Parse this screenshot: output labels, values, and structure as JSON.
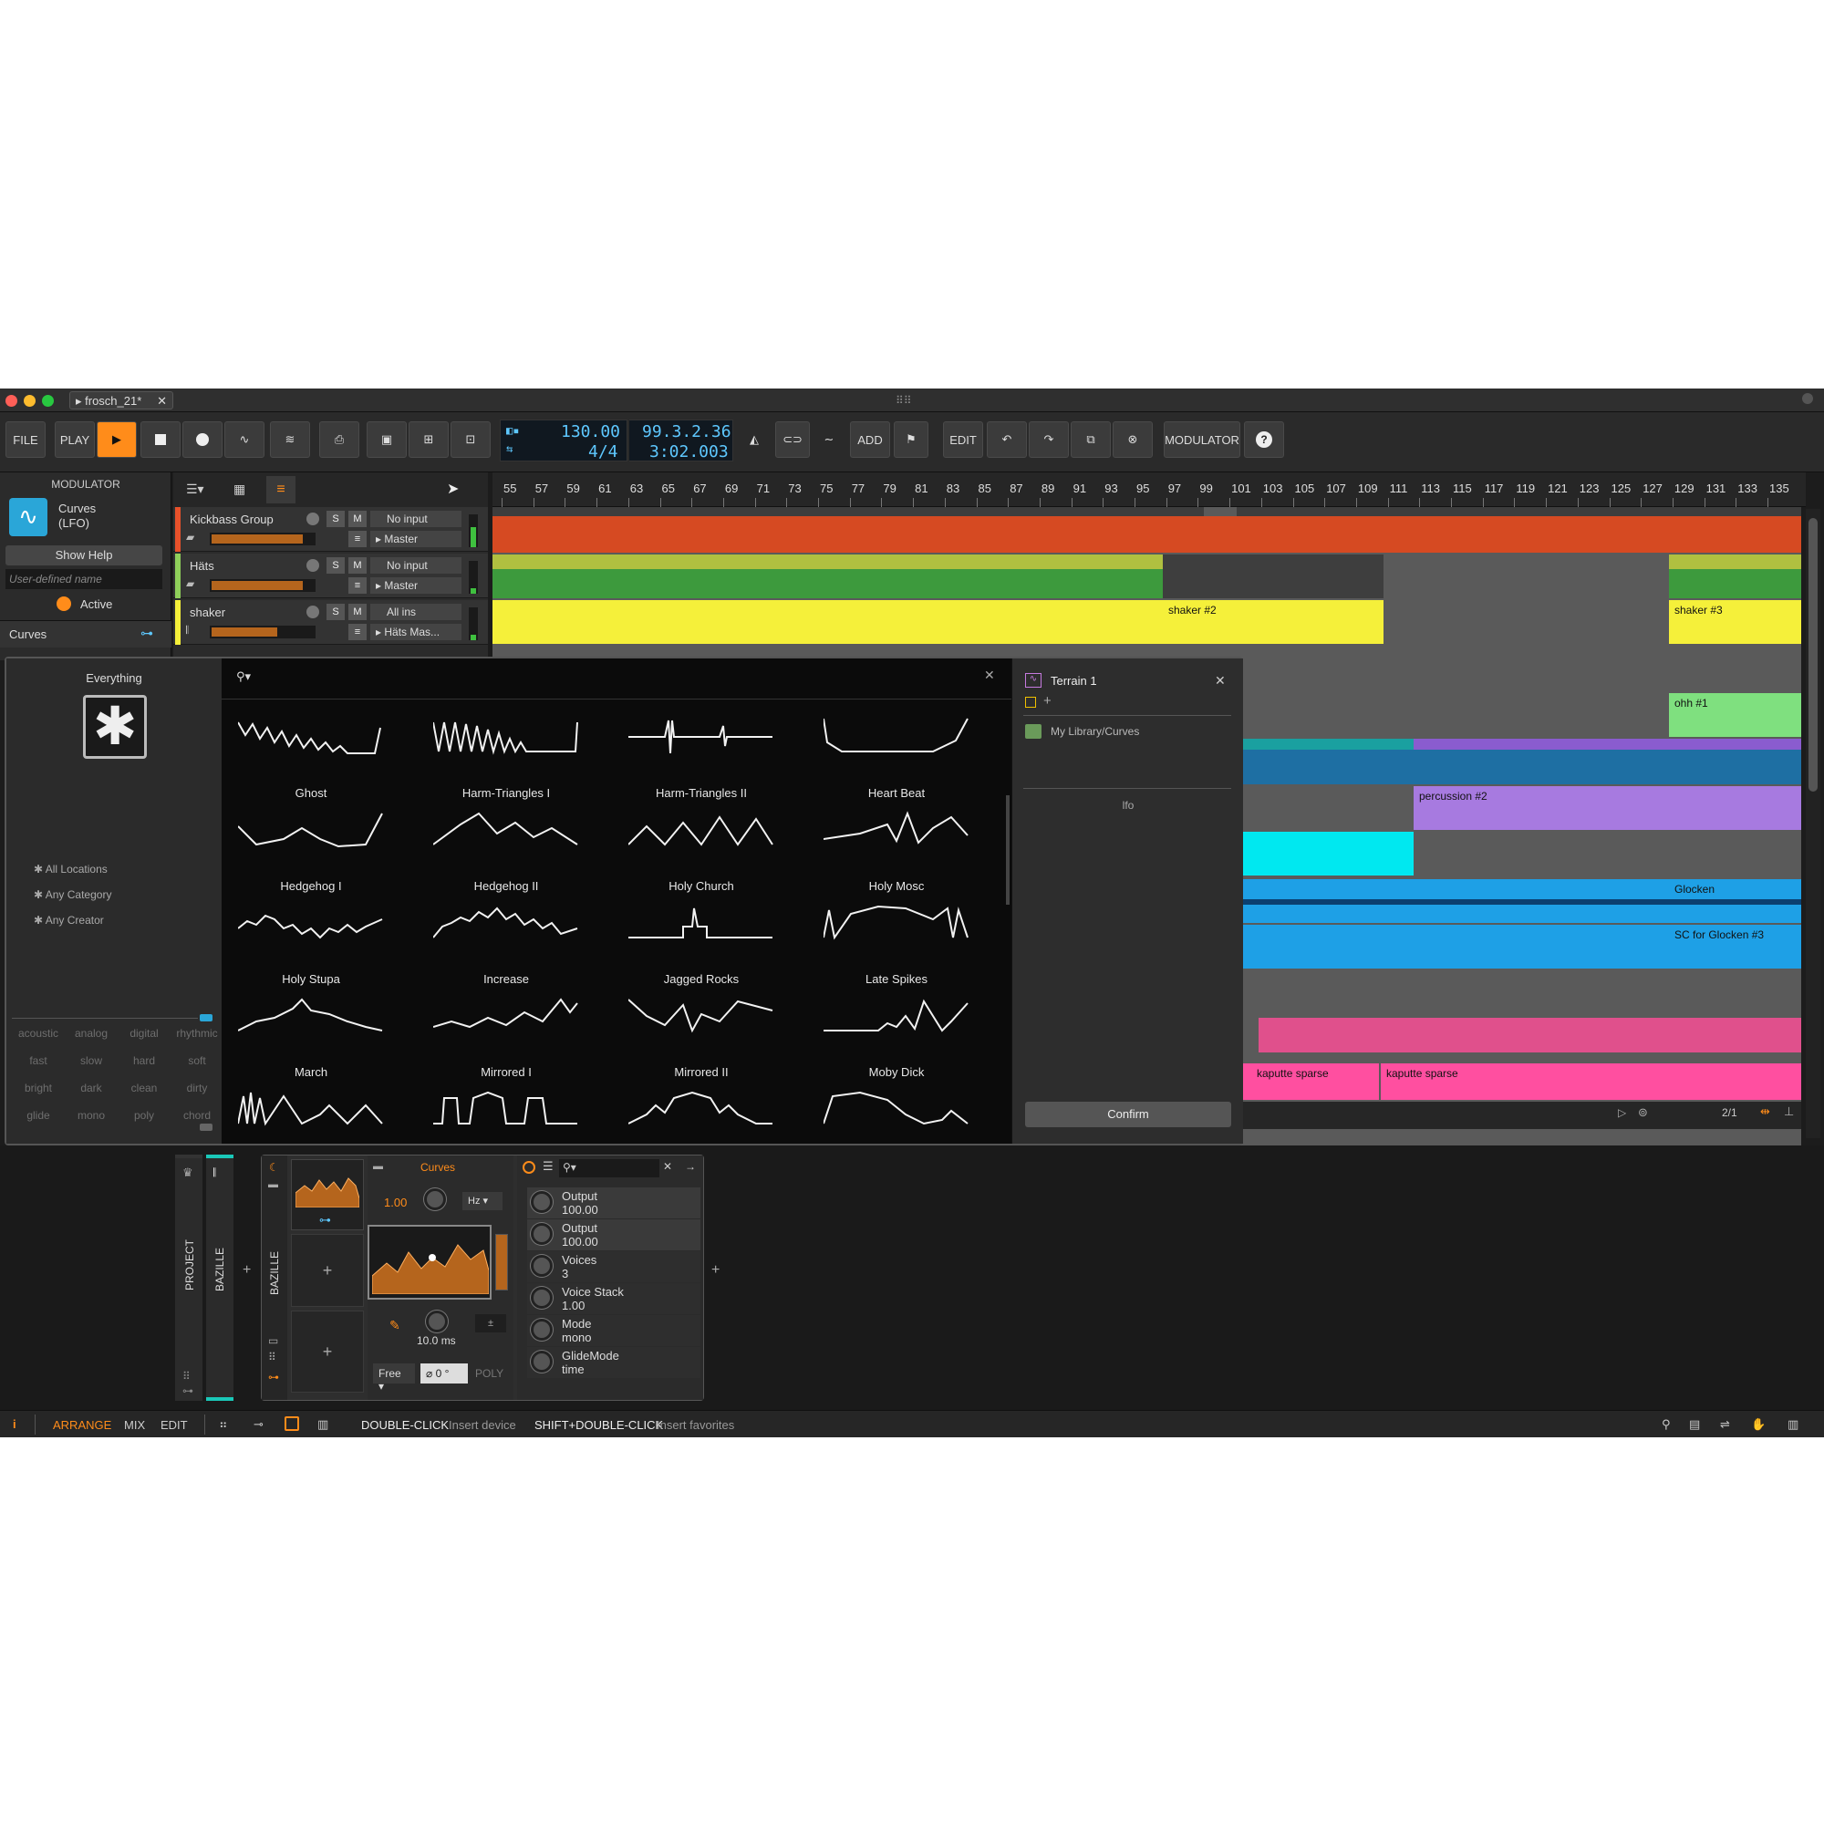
{
  "window": {
    "tab_title": "frosch_21*"
  },
  "toolbar": {
    "file": "FILE",
    "play": "PLAY",
    "add": "ADD",
    "edit": "EDIT",
    "modulator": "MODULATOR",
    "tempo": "130.00",
    "signature": "4/4",
    "position": "99.3.2.36",
    "time": "3:02.003"
  },
  "modulator_panel": {
    "header": "MODULATOR",
    "name": "Curves",
    "type": "(LFO)",
    "show_help": "Show Help",
    "name_placeholder": "User-defined name",
    "active": "Active",
    "curves": "Curves"
  },
  "tracks": [
    {
      "name": "Kickbass Group",
      "input": "No input",
      "output": "Master",
      "color": "#e8512a"
    },
    {
      "name": "Häts",
      "input": "No input",
      "output": "Master",
      "color": "#8fcf5a"
    },
    {
      "name": "shaker",
      "input": "All ins",
      "output": "Häts Mas...",
      "color": "#f5f03a"
    }
  ],
  "ruler": [
    "55",
    "57",
    "59",
    "61",
    "63",
    "65",
    "67",
    "69",
    "71",
    "73",
    "75",
    "77",
    "79",
    "81",
    "83",
    "85",
    "87",
    "89",
    "91",
    "93",
    "95",
    "97",
    "99",
    "101",
    "103",
    "105",
    "107",
    "109",
    "111",
    "113",
    "115",
    "117",
    "119",
    "121",
    "123",
    "125",
    "127",
    "129",
    "131",
    "133",
    "135"
  ],
  "clips": {
    "shaker2": "shaker #2",
    "shaker3": "shaker #3",
    "ohh1": "ohh #1",
    "perc2": "percussion #2",
    "glocken": "Glocken",
    "sc_glocken": "SC for Glocken #3",
    "kaputte1": "kaputte sparse",
    "kaputte2": "kaputte sparse"
  },
  "browser": {
    "everything": "Everything",
    "filters": [
      "All Locations",
      "Any Category",
      "Any Creator"
    ],
    "tags": [
      "acoustic",
      "analog",
      "digital",
      "rhythmic",
      "fast",
      "slow",
      "hard",
      "soft",
      "bright",
      "dark",
      "clean",
      "dirty",
      "glide",
      "mono",
      "poly",
      "chord"
    ],
    "presets": [
      "Ghost",
      "Harm-Triangles I",
      "Harm-Triangles II",
      "Heart Beat",
      "Hedgehog I",
      "Hedgehog II",
      "Holy Church",
      "Holy Mosc",
      "Holy Stupa",
      "Increase",
      "Jagged Rocks",
      "Late Spikes",
      "March",
      "Mirrored I",
      "Mirrored II",
      "Moby Dick"
    ],
    "selected_name": "Terrain 1",
    "location": "My Library/Curves",
    "category": "lfo",
    "confirm": "Confirm"
  },
  "device": {
    "project": "PROJECT",
    "bazille1": "BAZILLE",
    "bazille2": "BAZILLE",
    "curves": "Curves",
    "rate": "1.00",
    "rate_unit": "Hz",
    "smooth": "10.0 ms",
    "mode": "Free",
    "phase": "0 °",
    "poly": "POLY",
    "params": [
      {
        "name": "Output",
        "value": "100.00"
      },
      {
        "name": "Output",
        "value": "100.00"
      },
      {
        "name": "Voices",
        "value": "3"
      },
      {
        "name": "Voice Stack",
        "value": "1.00"
      },
      {
        "name": "Mode",
        "value": "mono"
      },
      {
        "name": "GlideMode",
        "value": "time"
      }
    ]
  },
  "statusbar": {
    "arrange": "ARRANGE",
    "mix": "MIX",
    "edit": "EDIT",
    "hint1_key": "DOUBLE-CLICK",
    "hint1": "Insert device",
    "hint2_key": "SHIFT+DOUBLE-CLICK",
    "hint2": "Insert favorites",
    "zoom": "2/1"
  },
  "colors": {
    "accent": "#ff8c1a",
    "lcd": "#5ec8ff"
  }
}
